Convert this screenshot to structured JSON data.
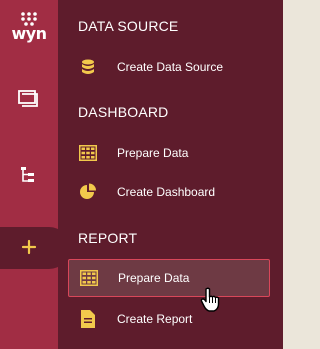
{
  "brand": {
    "name": "wyn"
  },
  "colors": {
    "rail": "#a12d44",
    "menu": "#5e1c2c",
    "accent": "#f2c94c",
    "selected_border": "#d9475a",
    "background": "#ebe6da"
  },
  "rail": {
    "icons": [
      "folder-icon",
      "hierarchy-icon",
      "plus-icon"
    ],
    "active": "plus-icon"
  },
  "menu": {
    "sections": [
      {
        "title": "DATA SOURCE",
        "items": [
          {
            "label": "Create Data Source",
            "icon": "database-icon"
          }
        ]
      },
      {
        "title": "DASHBOARD",
        "items": [
          {
            "label": "Prepare Data",
            "icon": "grid-icon"
          },
          {
            "label": "Create Dashboard",
            "icon": "pie-chart-icon"
          }
        ]
      },
      {
        "title": "REPORT",
        "items": [
          {
            "label": "Prepare Data",
            "icon": "grid-icon",
            "selected": true
          },
          {
            "label": "Create Report",
            "icon": "document-icon"
          }
        ]
      }
    ]
  }
}
